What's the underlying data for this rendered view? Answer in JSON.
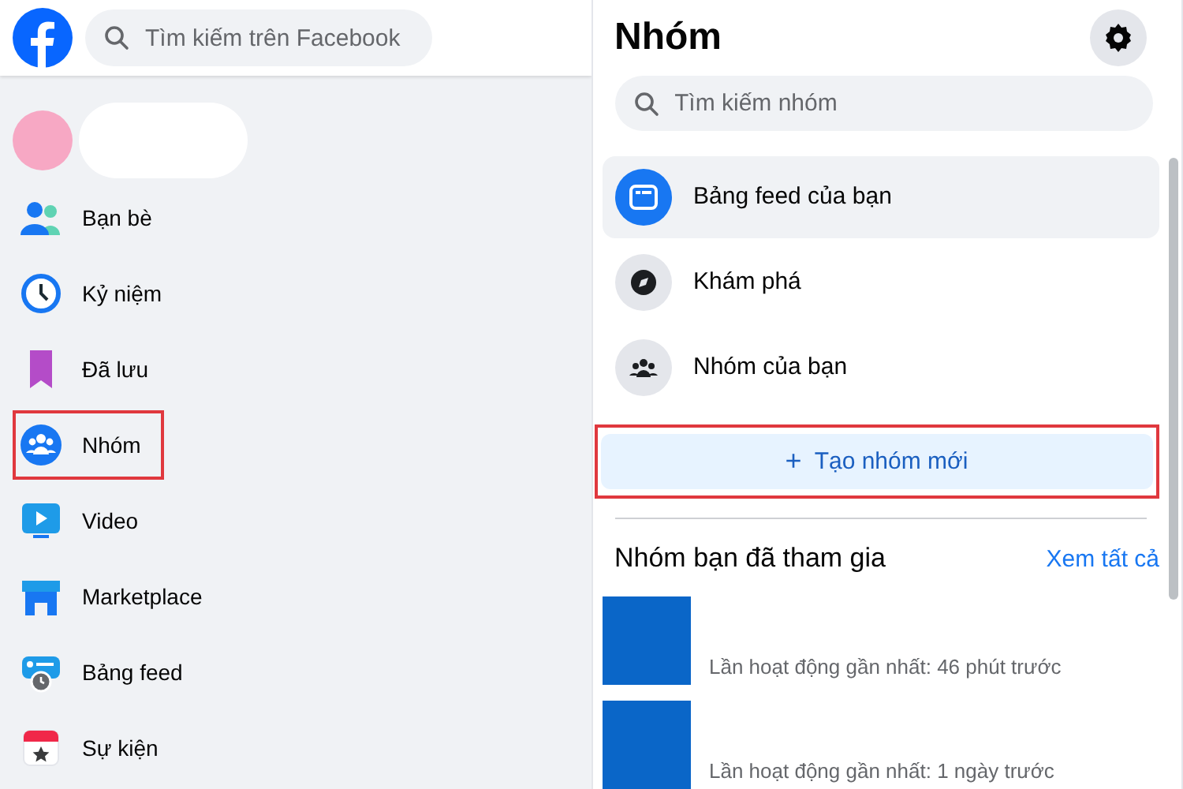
{
  "header": {
    "search": {
      "placeholder": "Tìm kiếm trên Facebook"
    }
  },
  "sidebar": {
    "items": [
      {
        "kind": "friends",
        "label": "Bạn bè",
        "highlighted": false
      },
      {
        "kind": "memories",
        "label": "Kỷ niệm",
        "highlighted": false
      },
      {
        "kind": "saved",
        "label": "Đã lưu",
        "highlighted": false
      },
      {
        "kind": "groups",
        "label": "Nhóm",
        "highlighted": true
      },
      {
        "kind": "video",
        "label": "Video",
        "highlighted": false
      },
      {
        "kind": "marketplace",
        "label": "Marketplace",
        "highlighted": false
      },
      {
        "kind": "feeds",
        "label": "Bảng feed",
        "highlighted": false
      },
      {
        "kind": "events",
        "label": "Sự kiện",
        "highlighted": false
      }
    ]
  },
  "groups_panel": {
    "title": "Nhóm",
    "search": {
      "placeholder": "Tìm kiếm nhóm"
    },
    "menu": [
      {
        "kind": "feed",
        "label": "Bảng feed của bạn",
        "selected": true
      },
      {
        "kind": "discover",
        "label": "Khám phá",
        "selected": false
      },
      {
        "kind": "your_groups",
        "label": "Nhóm của bạn",
        "selected": false
      }
    ],
    "create_button": {
      "icon": "+",
      "label": "Tạo nhóm mới",
      "highlighted": true
    },
    "joined": {
      "heading": "Nhóm bạn đã tham gia",
      "see_all": "Xem tất cả",
      "groups": [
        {
          "activity": "Lần hoạt động gần nhất: 46 phút trước"
        },
        {
          "activity": "Lần hoạt động gần nhất: 1 ngày trước"
        }
      ]
    }
  }
}
